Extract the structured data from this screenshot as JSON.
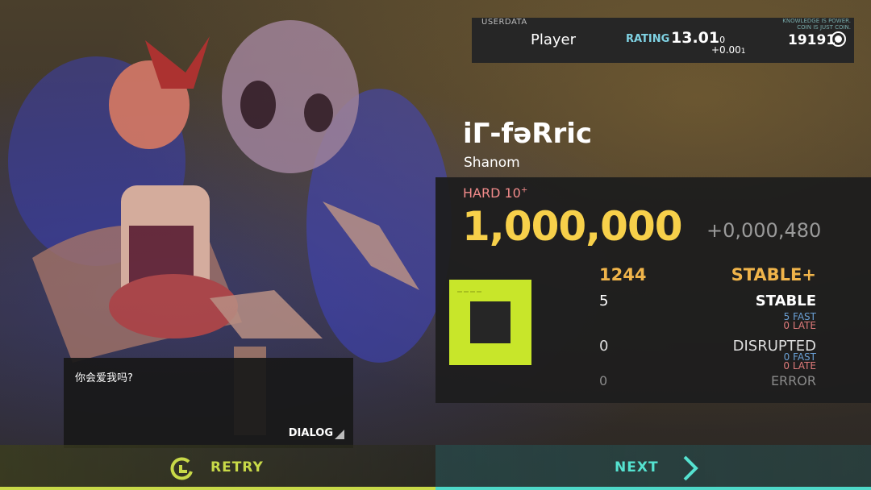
{
  "userbar": {
    "section_label": "USERDATA",
    "player_name": "Player",
    "rating_label": "RATING",
    "rating_value": "13.01",
    "rating_value_small": "0",
    "rating_delta": "+0.00",
    "rating_delta_small": "1",
    "motto_line1": "KNOWLEDGE IS POWER.",
    "motto_line2": "COIN IS JUST COIN.",
    "coins": "19191",
    "coin_icon": "coin-icon"
  },
  "song": {
    "title": "iΓ-fəRric",
    "artist": "Shanom",
    "difficulty": "HARD 10",
    "difficulty_plus": "+",
    "score": "1,000,000",
    "score_delta": "+0,000,480"
  },
  "judgements": {
    "max_combo": "1244",
    "grade": "STABLE+",
    "stable_count": "5",
    "stable_label": "STABLE",
    "stable_fast": "5 FAST",
    "stable_late": "0 LATE",
    "disrupted_count": "0",
    "disrupted_label": "DISRUPTED",
    "disrupted_fast": "0 FAST",
    "disrupted_late": "0 LATE",
    "error_count": "0",
    "error_label": "ERROR"
  },
  "dialog": {
    "text": "你会爱我吗?",
    "label": "DIALOG"
  },
  "buttons": {
    "retry": "RETRY",
    "next": "NEXT"
  },
  "colors": {
    "score": "#f7d04a",
    "grade": "#f0b44a",
    "difficulty": "#f28b8b",
    "judge_icon": "#c8e62a",
    "fast": "#6a9fd4",
    "late": "#e07b7b",
    "retry": "#c8d948",
    "next": "#55e2d0"
  }
}
